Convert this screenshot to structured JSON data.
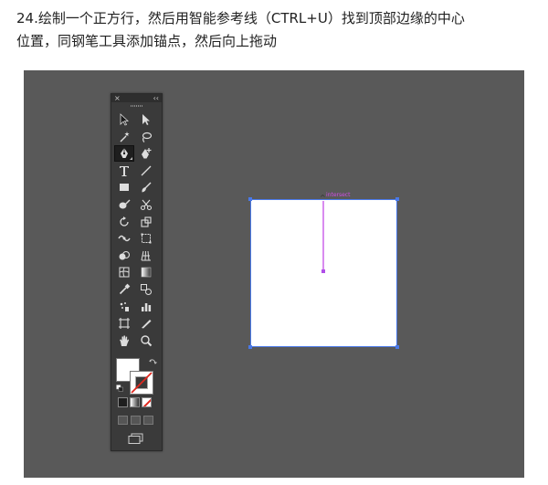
{
  "caption": {
    "line1": "24.绘制一个正方行，然后用智能参考线（CTRL+U）找到顶部边缘的中心",
    "line2": "位置，同钢笔工具添加锚点，然后向上拖动"
  },
  "tools_panel": {
    "close_glyph": "×",
    "collapse_glyph": "‹‹",
    "rows": [
      [
        "selection-tool",
        "direct-selection-tool"
      ],
      [
        "magic-wand-tool",
        "lasso-tool"
      ],
      [
        "pen-tool",
        "add-anchor-point-tool"
      ],
      [
        "type-tool",
        "line-segment-tool"
      ],
      [
        "rectangle-tool",
        "paintbrush-tool"
      ],
      [
        "blob-brush-tool",
        "scissors-tool"
      ],
      [
        "rotate-tool",
        "scale-tool"
      ],
      [
        "width-tool",
        "free-transform-tool"
      ],
      [
        "shape-builder-tool",
        "perspective-grid-tool"
      ],
      [
        "mesh-tool",
        "gradient-tool"
      ],
      [
        "eyedropper-tool",
        "blend-tool"
      ],
      [
        "symbol-sprayer-tool",
        "column-graph-tool"
      ],
      [
        "artboard-tool",
        "slice-tool"
      ],
      [
        "hand-tool",
        "zoom-tool"
      ]
    ],
    "active_tool": "pen-tool"
  },
  "canvas": {
    "smart_guide_label": "intersect",
    "fill_color": "#ffffff",
    "selection_color": "#4a79e8",
    "guide_color": "#d98bf0"
  }
}
